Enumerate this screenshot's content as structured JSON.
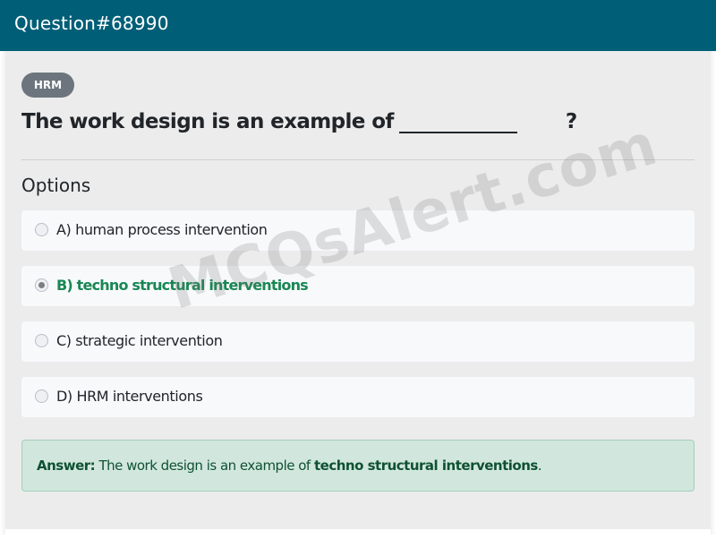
{
  "header": {
    "title": "Question#68990"
  },
  "category_badge": "HRM",
  "question": {
    "text": "The work design is an example of",
    "end": "?"
  },
  "options_heading": "Options",
  "options": [
    {
      "label": "A) human process intervention",
      "selected": false
    },
    {
      "label": "B) techno structural interventions",
      "selected": true
    },
    {
      "label": "C) strategic intervention",
      "selected": false
    },
    {
      "label": "D) HRM interventions",
      "selected": false
    }
  ],
  "answer": {
    "prefix": "Answer:",
    "text": "The work design is an example of",
    "value": "techno structural interventions",
    "suffix": "."
  },
  "watermark": "MCQsAlert.com",
  "colors": {
    "header_bg": "#005e77",
    "badge_bg": "#6c757d",
    "correct_text": "#198754",
    "answer_bg": "#d1e7dd"
  }
}
